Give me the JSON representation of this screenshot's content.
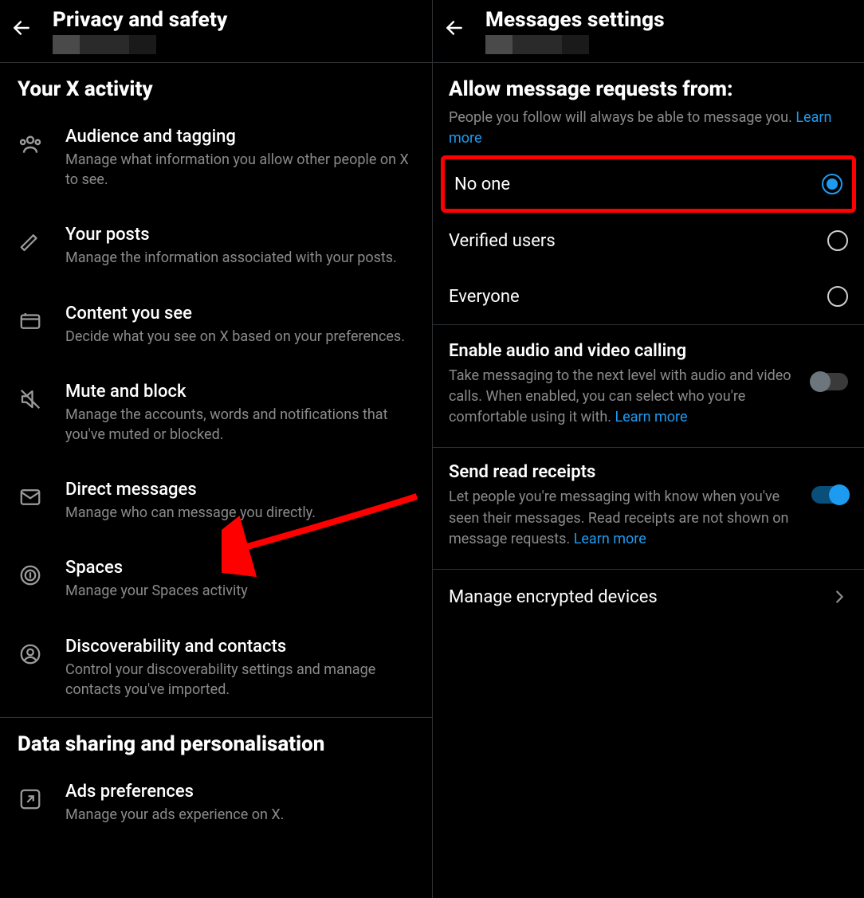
{
  "left": {
    "title": "Privacy and safety",
    "section1": "Your X activity",
    "section2": "Data sharing and personalisation",
    "items": [
      {
        "title": "Audience and tagging",
        "desc": "Manage what information you allow other people on X to see."
      },
      {
        "title": "Your posts",
        "desc": "Manage the information associated with your posts."
      },
      {
        "title": "Content you see",
        "desc": "Decide what you see on X based on your preferences."
      },
      {
        "title": "Mute and block",
        "desc": "Manage the accounts, words and notifications that you've muted or blocked."
      },
      {
        "title": "Direct messages",
        "desc": "Manage who can message you directly."
      },
      {
        "title": "Spaces",
        "desc": "Manage your Spaces activity"
      },
      {
        "title": "Discoverability and contacts",
        "desc": "Control your discoverability settings and manage contacts you've imported."
      }
    ],
    "items2": [
      {
        "title": "Ads preferences",
        "desc": "Manage your ads experience on X."
      }
    ]
  },
  "right": {
    "title": "Messages settings",
    "allow_heading": "Allow message requests from:",
    "allow_desc": "People you follow will always be able to message you. ",
    "learn_more": "Learn more",
    "radios": [
      {
        "label": "No one",
        "selected": true
      },
      {
        "label": "Verified users",
        "selected": false
      },
      {
        "label": "Everyone",
        "selected": false
      }
    ],
    "av_title": "Enable audio and video calling",
    "av_desc": "Take messaging to the next level with audio and video calls. When enabled, you can select who you're comfortable using it with. ",
    "rr_title": "Send read receipts",
    "rr_desc": "Let people you're messaging with know when you've seen their messages. Read receipts are not shown on message requests. ",
    "encrypted": "Manage encrypted devices"
  }
}
